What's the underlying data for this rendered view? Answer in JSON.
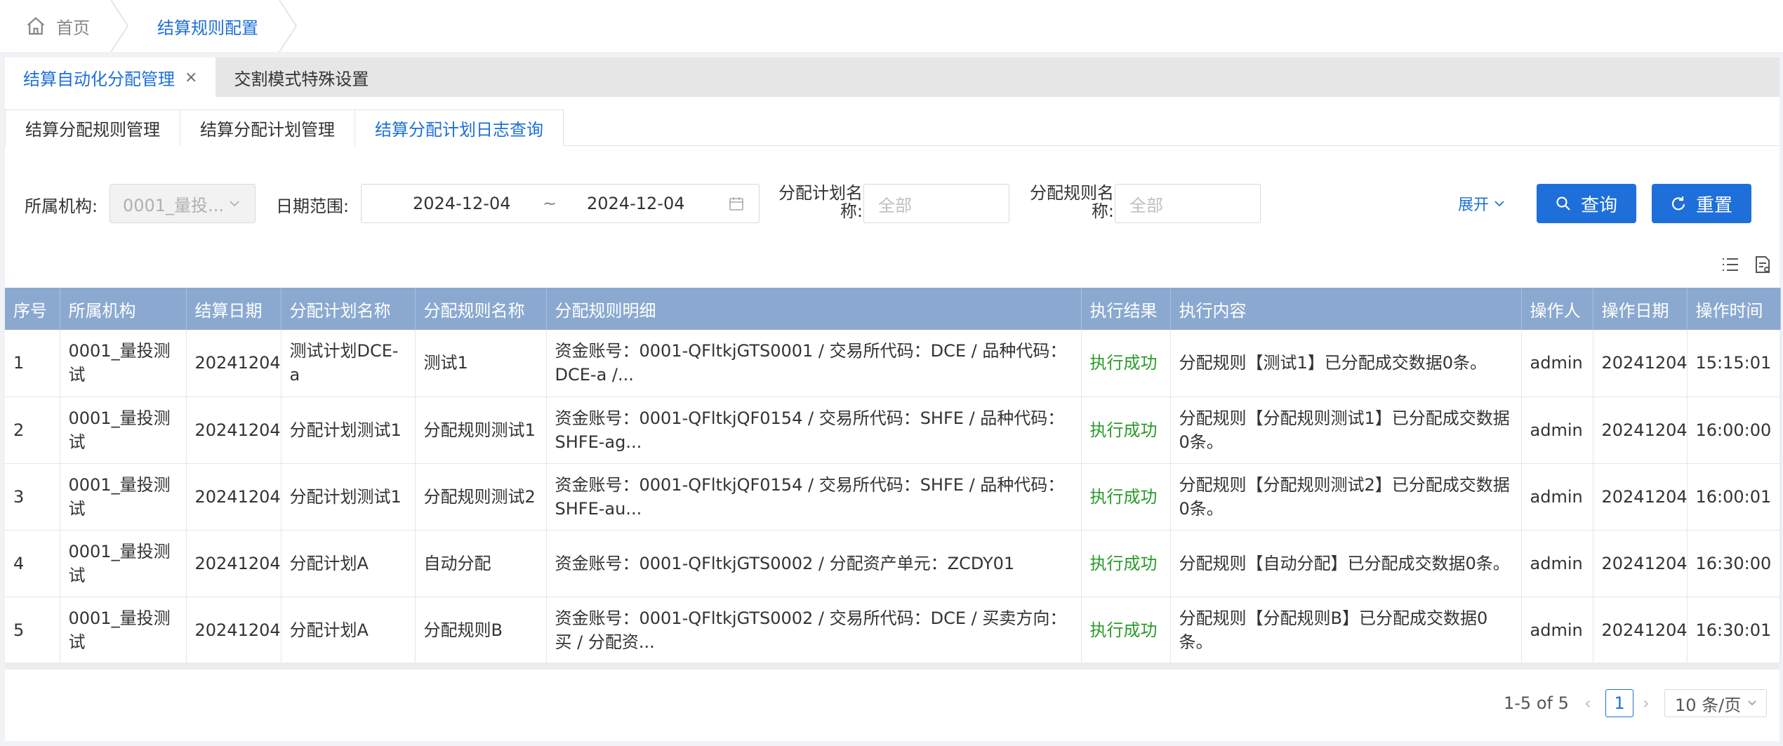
{
  "breadcrumb": {
    "home": "首页",
    "current": "结算规则配置"
  },
  "tabs_top": [
    {
      "label": "结算自动化分配管理",
      "close": "×",
      "active": true
    },
    {
      "label": "交割模式特殊设置",
      "active": false
    }
  ],
  "tabs_sub": [
    {
      "label": "结算分配规则管理",
      "active": false
    },
    {
      "label": "结算分配计划管理",
      "active": false
    },
    {
      "label": "结算分配计划日志查询",
      "active": true
    }
  ],
  "filters": {
    "org_label": "所属机构:",
    "org_value": "0001_量投...",
    "date_label": "日期范围:",
    "date_start": "2024-12-04",
    "date_sep": "~",
    "date_end": "2024-12-04",
    "plan_label_1": "分配计划名",
    "plan_label_2": "称:",
    "plan_placeholder": "全部",
    "rule_label_1": "分配规则名",
    "rule_label_2": "称:",
    "rule_placeholder": "全部",
    "expand": "展开",
    "search_btn": "查询",
    "reset_btn": "重置"
  },
  "table": {
    "headers": [
      "序号",
      "所属机构",
      "结算日期",
      "分配计划名称",
      "分配规则名称",
      "分配规则明细",
      "执行结果",
      "执行内容",
      "操作人",
      "操作日期",
      "操作时间"
    ],
    "rows": [
      [
        "1",
        "0001_量投测试",
        "20241204",
        "测试计划DCE-a",
        "测试1",
        "资金账号：0001-QFltkjGTS0001 / 交易所代码：DCE / 品种代码：DCE-a /...",
        "执行成功",
        "分配规则【测试1】已分配成交数据0条。",
        "admin",
        "20241204",
        "15:15:01"
      ],
      [
        "2",
        "0001_量投测试",
        "20241204",
        "分配计划测试1",
        "分配规则测试1",
        "资金账号：0001-QFltkjQF0154 / 交易所代码：SHFE / 品种代码：SHFE-ag...",
        "执行成功",
        "分配规则【分配规则测试1】已分配成交数据0条。",
        "admin",
        "20241204",
        "16:00:00"
      ],
      [
        "3",
        "0001_量投测试",
        "20241204",
        "分配计划测试1",
        "分配规则测试2",
        "资金账号：0001-QFltkjQF0154 / 交易所代码：SHFE / 品种代码：SHFE-au...",
        "执行成功",
        "分配规则【分配规则测试2】已分配成交数据0条。",
        "admin",
        "20241204",
        "16:00:01"
      ],
      [
        "4",
        "0001_量投测试",
        "20241204",
        "分配计划A",
        "自动分配",
        "资金账号：0001-QFltkjGTS0002 / 分配资产单元：ZCDY01",
        "执行成功",
        "分配规则【自动分配】已分配成交数据0条。",
        "admin",
        "20241204",
        "16:30:00"
      ],
      [
        "5",
        "0001_量投测试",
        "20241204",
        "分配计划A",
        "分配规则B",
        "资金账号：0001-QFltkjGTS0002 / 交易所代码：DCE / 买卖方向：买 / 分配资...",
        "执行成功",
        "分配规则【分配规则B】已分配成交数据0条。",
        "admin",
        "20241204",
        "16:30:01"
      ]
    ]
  },
  "pagination": {
    "total": "1-5 of 5",
    "page": "1",
    "page_size": "10 条/页"
  },
  "colors": {
    "accent": "#1e6fd9",
    "header_bg": "#8ba9d0",
    "success": "#2a9a2a"
  }
}
